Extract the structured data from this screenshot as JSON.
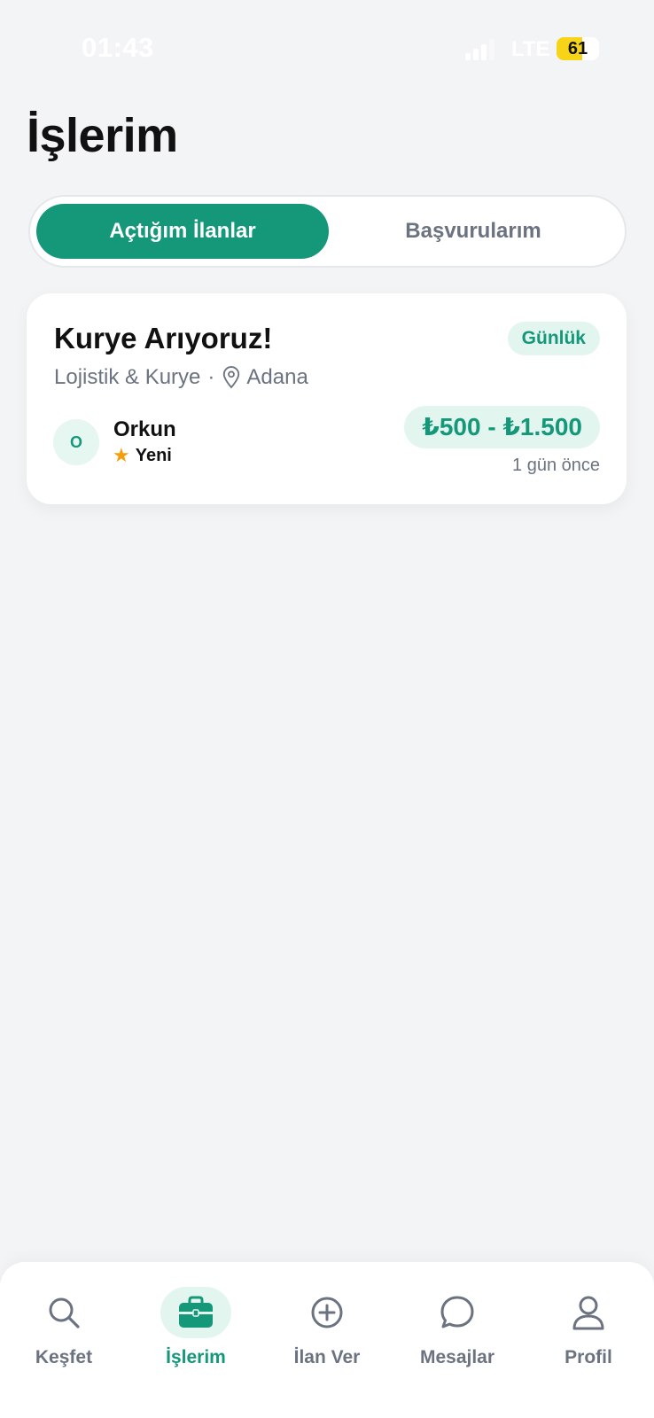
{
  "status_bar": {
    "time": "01:43",
    "network": "LTE",
    "battery": "61",
    "battery_level": 0.61
  },
  "page": {
    "title": "İşlerim"
  },
  "tabs": [
    {
      "label": "Açtığım İlanlar",
      "active": true
    },
    {
      "label": "Başvurularım",
      "active": false
    }
  ],
  "job": {
    "title": "Kurye Arıyoruz!",
    "badge": "Günlük",
    "category": "Lojistik & Kurye",
    "separator": "·",
    "location": "Adana",
    "owner_initial": "O",
    "owner_name": "Orkun",
    "owner_rating_label": "Yeni",
    "price": "₺500 - ₺1.500",
    "posted": "1 gün önce"
  },
  "nav": {
    "items": [
      {
        "label": "Keşfet",
        "icon": "search-icon",
        "active": false
      },
      {
        "label": "İşlerim",
        "icon": "briefcase-icon",
        "active": true
      },
      {
        "label": "İlan Ver",
        "icon": "plus-circle-icon",
        "active": false
      },
      {
        "label": "Mesajlar",
        "icon": "chat-bubble-icon",
        "active": false
      },
      {
        "label": "Profil",
        "icon": "user-icon",
        "active": false
      }
    ]
  },
  "colors": {
    "accent": "#15987a",
    "accent_soft": "#e3f5ef",
    "background": "#f3f4f6",
    "muted_text": "#6b7280",
    "star": "#f59e0b",
    "battery": "#f7d417"
  }
}
